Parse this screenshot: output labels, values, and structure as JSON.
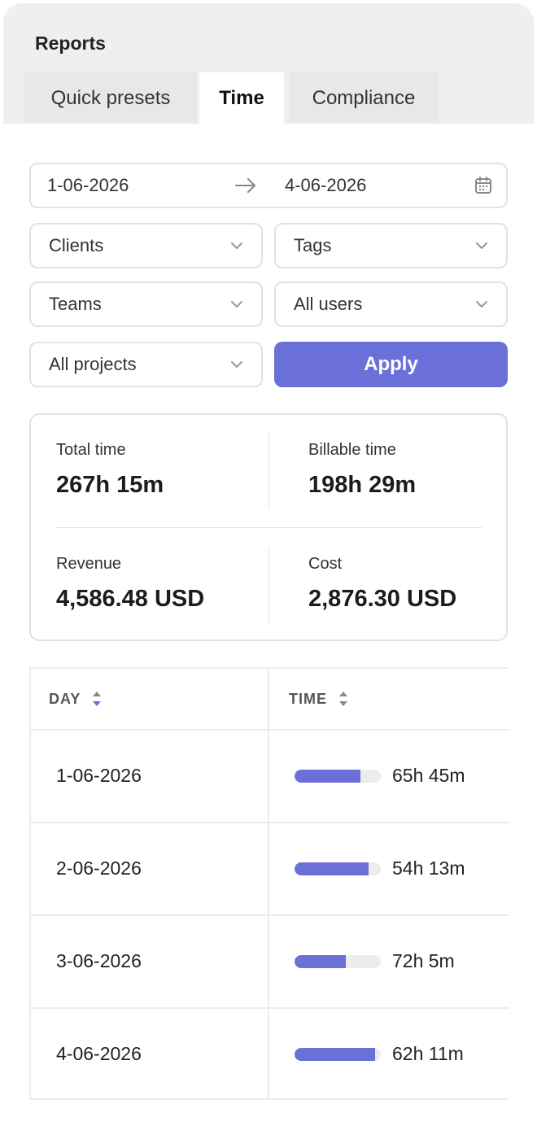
{
  "app": {
    "title": "Reports"
  },
  "tabs": [
    {
      "label": "Quick presets",
      "active": false
    },
    {
      "label": "Time",
      "active": true
    },
    {
      "label": "Compliance",
      "active": false
    }
  ],
  "filters": {
    "date_from": "1-06-2026",
    "date_to": "4-06-2026",
    "clients": "Clients",
    "tags": "Tags",
    "teams": "Teams",
    "users": "All users",
    "projects": "All projects",
    "apply_label": "Apply"
  },
  "summary": {
    "total_time_label": "Total time",
    "total_time": "267h 15m",
    "billable_time_label": "Billable time",
    "billable_time": "198h 29m",
    "revenue_label": "Revenue",
    "revenue": "4,586.48 USD",
    "cost_label": "Cost",
    "cost": "2,876.30 USD"
  },
  "table": {
    "columns": [
      "DAY",
      "TIME"
    ],
    "rows": [
      {
        "day": "1-06-2026",
        "time": "65h 45m",
        "progress": 0.76
      },
      {
        "day": "2-06-2026",
        "time": "54h 13m",
        "progress": 0.86
      },
      {
        "day": "3-06-2026",
        "time": "72h 5m",
        "progress": 0.59
      },
      {
        "day": "4-06-2026",
        "time": "62h 11m",
        "progress": 0.93
      }
    ]
  },
  "colors": {
    "accent": "#6b6fd8",
    "header_bg": "#efefef",
    "border": "#e2e2e2"
  }
}
